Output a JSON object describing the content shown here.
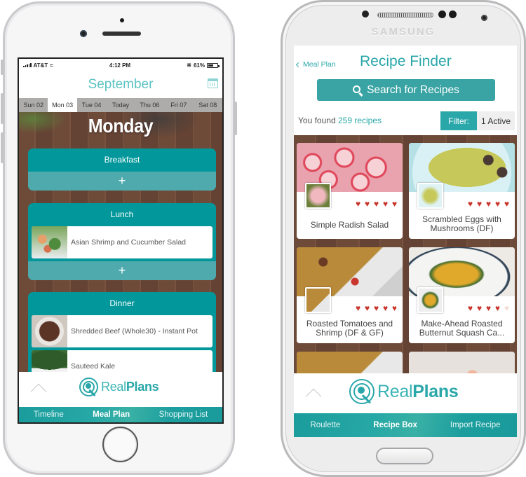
{
  "iphone": {
    "status_bar": {
      "carrier": "AT&T",
      "time": "4:12 PM",
      "battery": "61%",
      "battery_level": 0.61
    },
    "header": {
      "month": "September",
      "calendar_icon": "calendar-icon"
    },
    "day_tabs": [
      {
        "label": "Sun 02",
        "active": false
      },
      {
        "label": "Mon 03",
        "active": true
      },
      {
        "label": "Tue 04",
        "active": false
      },
      {
        "label": "Today",
        "active": false
      },
      {
        "label": "Thu 06",
        "active": false
      },
      {
        "label": "Fri 07",
        "active": false
      },
      {
        "label": "Sat 08",
        "active": false
      }
    ],
    "day_title": "Monday",
    "meals": [
      {
        "title": "Breakfast",
        "items": [],
        "add_label": "+"
      },
      {
        "title": "Lunch",
        "items": [
          {
            "name": "Asian Shrimp and Cucumber Salad"
          }
        ],
        "add_label": "+"
      },
      {
        "title": "Dinner",
        "items": [
          {
            "name": "Shredded Beef (Whole30) - Instant Pot"
          },
          {
            "name": "Sauteed Kale"
          }
        ]
      }
    ],
    "logo": {
      "light": "Real",
      "bold": "Plans"
    },
    "tabs": [
      {
        "label": "Timeline",
        "active": false
      },
      {
        "label": "Meal Plan",
        "active": true
      },
      {
        "label": "Shopping List",
        "active": false
      }
    ]
  },
  "android": {
    "brand": "SAMSUNG",
    "back_label": "Meal Plan",
    "title": "Recipe Finder",
    "search_label": "Search for Recipes",
    "found_prefix": "You found",
    "found_count": "259 recipes",
    "filter_label": "Filter:",
    "filter_value": "1 Active",
    "recipes": [
      {
        "name": "Simple Radish Salad",
        "rating": 5
      },
      {
        "name": "Scrambled Eggs with Mushrooms (DF)",
        "rating": 5
      },
      {
        "name": "Roasted Tomatoes and Shrimp (DF & GF)",
        "rating": 4.5
      },
      {
        "name": "Make-Ahead Roasted Butternut Squash Ca...",
        "rating": 3.5
      }
    ],
    "logo": {
      "light": "Real",
      "bold": "Plans"
    },
    "tabs": [
      {
        "label": "Roulette",
        "active": false
      },
      {
        "label": "Recipe Box",
        "active": true
      },
      {
        "label": "Import Recipe",
        "active": false
      }
    ]
  },
  "colors": {
    "teal": "#02979b",
    "teal_light": "#4eaaad",
    "heart": "#c9362d",
    "accent_text": "#2aa7a9"
  }
}
